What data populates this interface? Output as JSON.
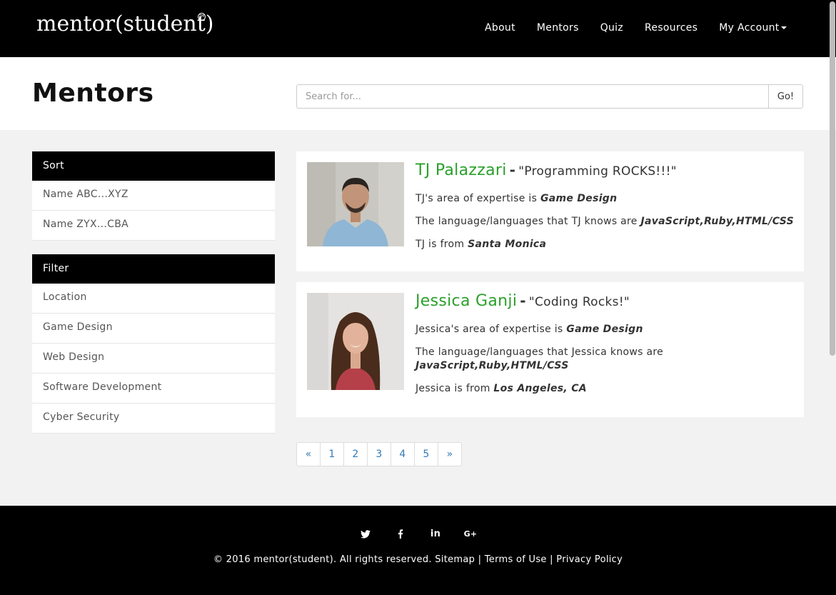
{
  "nav": {
    "logo_text": "mentor(student)",
    "logo_tm": "TM",
    "links": [
      "About",
      "Mentors",
      "Quiz",
      "Resources",
      "My Account"
    ]
  },
  "header": {
    "title": "Mentors",
    "search_placeholder": "Search for...",
    "search_value": "",
    "go_label": "Go!"
  },
  "sort": {
    "heading": "Sort",
    "items": [
      "Name ABC...XYZ",
      "Name ZYX...CBA"
    ]
  },
  "filter": {
    "heading": "Filter",
    "items": [
      "Location",
      "Game Design",
      "Web Design",
      "Software Development",
      "Cyber Security"
    ]
  },
  "mentors": [
    {
      "name": "TJ Palazzari",
      "dash": "-",
      "quote": "\"Programming ROCKS!!!\"",
      "expertise_prefix": "TJ's area of expertise is ",
      "expertise": "Game Design",
      "languages_prefix": "The language/languages that TJ knows are ",
      "languages": "JavaScript,Ruby,HTML/CSS",
      "location_prefix": "TJ is from ",
      "location": "Santa Monica"
    },
    {
      "name": "Jessica Ganji",
      "dash": "-",
      "quote": "\"Coding Rocks!\"",
      "expertise_prefix": "Jessica's area of expertise is ",
      "expertise": "Game Design",
      "languages_prefix": "The language/languages that Jessica knows are ",
      "languages": "JavaScript,Ruby,HTML/CSS",
      "location_prefix": "Jessica is from ",
      "location": "Los Angeles, CA"
    }
  ],
  "pagination": [
    "«",
    "1",
    "2",
    "3",
    "4",
    "5",
    "»"
  ],
  "footer": {
    "social_icons": [
      "twitter-icon",
      "facebook-icon",
      "linkedin-icon",
      "google-plus-icon"
    ],
    "social_glyphs": [
      "t",
      "f",
      "in",
      "G+"
    ],
    "copyright": "© 2016 mentor(student). All rights reserved.",
    "sitemap": "Sitemap",
    "separator": "|",
    "terms": "Terms of Use",
    "privacy": "Privacy Policy"
  },
  "colors": {
    "name_green": "#2aa02a",
    "link_blue": "#337ab7",
    "nav_black": "#000000"
  }
}
